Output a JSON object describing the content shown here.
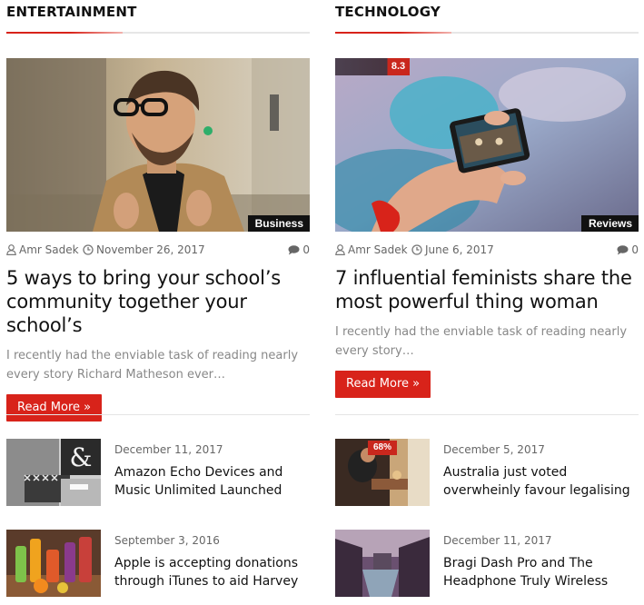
{
  "columns": [
    {
      "section_title": "ENTERTAINMENT",
      "feature": {
        "image": "man-in-camel-coat-with-glasses",
        "category": "Business",
        "author": "Amr Sadek",
        "date": "November 26, 2017",
        "comments": "0",
        "title": "5 ways to bring your school’s community together your school’s",
        "excerpt": "I recently had the enviable task of reading nearly every story Richard Matheson ever…",
        "read_more": "Read More »"
      },
      "list": [
        {
          "image": "living-room-ampersand-decor",
          "date": "December 11, 2017",
          "title": "Amazon Echo Devices and Music Unlimited Launched"
        },
        {
          "image": "colorful-drinks-bottles",
          "date": "September 3, 2016",
          "title": "Apple is accepting donations through iTunes to aid Harvey"
        }
      ]
    },
    {
      "section_title": "TECHNOLOGY",
      "feature": {
        "image": "hand-holding-smartphone-concert",
        "score": "8.3",
        "score_fraction": 0.83,
        "category": "Reviews",
        "author": "Amr Sadek",
        "date": "June 6, 2017",
        "comments": "0",
        "title": "7 influential feminists share the most powerful thing woman",
        "excerpt": "I recently had the enviable task of reading nearly every story…",
        "read_more": "Read More »"
      },
      "list": [
        {
          "image": "man-at-cafe-window",
          "score": "68%",
          "score_fraction": 0.68,
          "date": "December 5, 2017",
          "title": "Australia just voted overwheinly favour legalising"
        },
        {
          "image": "canal-city-buildings",
          "date": "December 11, 2017",
          "title": "Bragi Dash Pro and The Headphone Truly Wireless"
        }
      ]
    }
  ],
  "icons": {
    "author": "user-icon",
    "date": "clock-icon",
    "comments": "comment-icon"
  },
  "colors": {
    "accent": "#d8231a",
    "badge_bg": "#111111",
    "meta_text": "#666666",
    "excerpt_text": "#888888"
  }
}
